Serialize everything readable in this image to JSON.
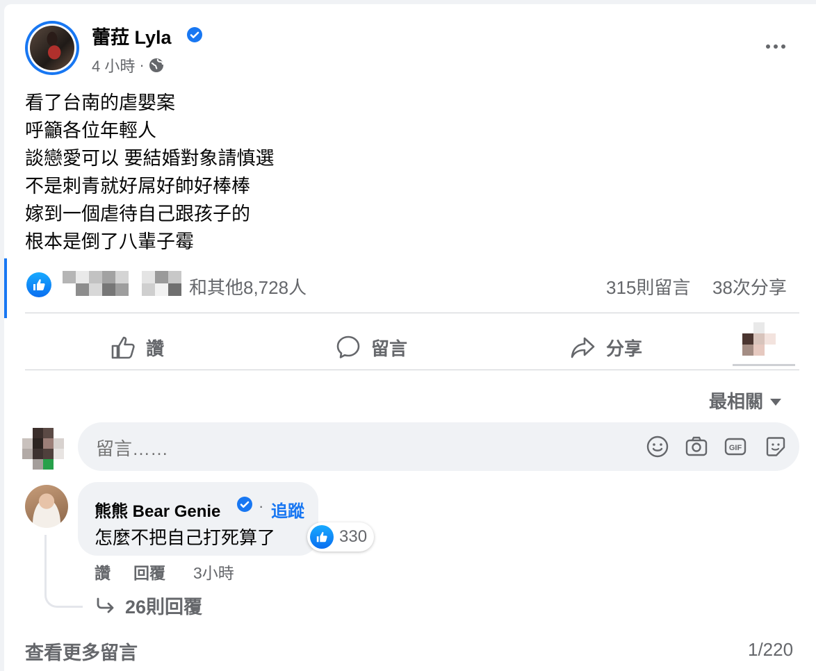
{
  "post": {
    "author": "蕾菈 Lyla",
    "time": "4 小時",
    "separator": "·",
    "lines": [
      "看了台南的虐嬰案",
      "呼籲各位年輕人",
      "談戀愛可以 要結婚對象請慎選",
      "不是刺青就好屌好帥好棒棒",
      "嫁到一個虐待自己跟孩子的",
      "根本是倒了八輩子霉"
    ]
  },
  "stats": {
    "reactions": "和其他8,728人",
    "comments": "315則留言",
    "shares": "38次分享"
  },
  "actions": {
    "like": "讚",
    "comment": "留言",
    "share": "分享"
  },
  "sort": {
    "label": "最相關"
  },
  "composer": {
    "placeholder": "留言……"
  },
  "comment": {
    "author": "熊熊 Bear Genie",
    "dot": "·",
    "follow": "追蹤",
    "text": "怎麼不把自己打死算了",
    "reactions": "330",
    "like": "讚",
    "reply": "回覆",
    "time": "3小時",
    "replies": "26則回覆"
  },
  "footer": {
    "more_comments": "查看更多留言",
    "pager": "1/220"
  },
  "colors": {
    "accent": "#1877f2",
    "muted": "#65676b",
    "bubble": "#f0f2f5"
  }
}
